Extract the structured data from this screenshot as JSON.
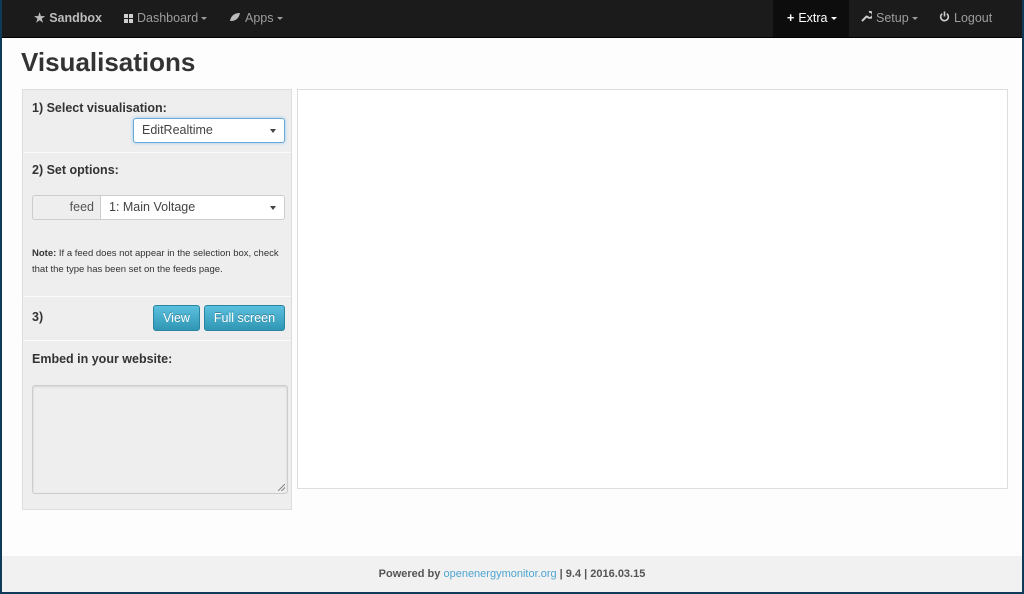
{
  "nav": {
    "brand": "Sandbox",
    "dashboard": "Dashboard",
    "apps": "Apps",
    "extra": "Extra",
    "setup": "Setup",
    "logout": "Logout"
  },
  "page": {
    "title": "Visualisations"
  },
  "panel": {
    "step1_label": "1) Select visualisation:",
    "visualisation_selected": "EditRealtime",
    "step2_label": "2) Set options:",
    "feed_label": "feed",
    "feed_selected": "1: Main Voltage",
    "note_bold": "Note:",
    "note_text": " If a feed does not appear in the selection box, check that the type has been set on the feeds page.",
    "step3_label": "3)",
    "view_button": "View",
    "fullscreen_button": "Full screen",
    "embed_label": "Embed in your website:",
    "embed_value": ""
  },
  "footer": {
    "powered_by": "Powered by",
    "link": "openenergymonitor.org",
    "suffix": "| 9.4 | 2016.03.15"
  },
  "colors": {
    "navbar": "#1b1b1b",
    "button": "#49afcd",
    "link": "#4fa5d0"
  }
}
